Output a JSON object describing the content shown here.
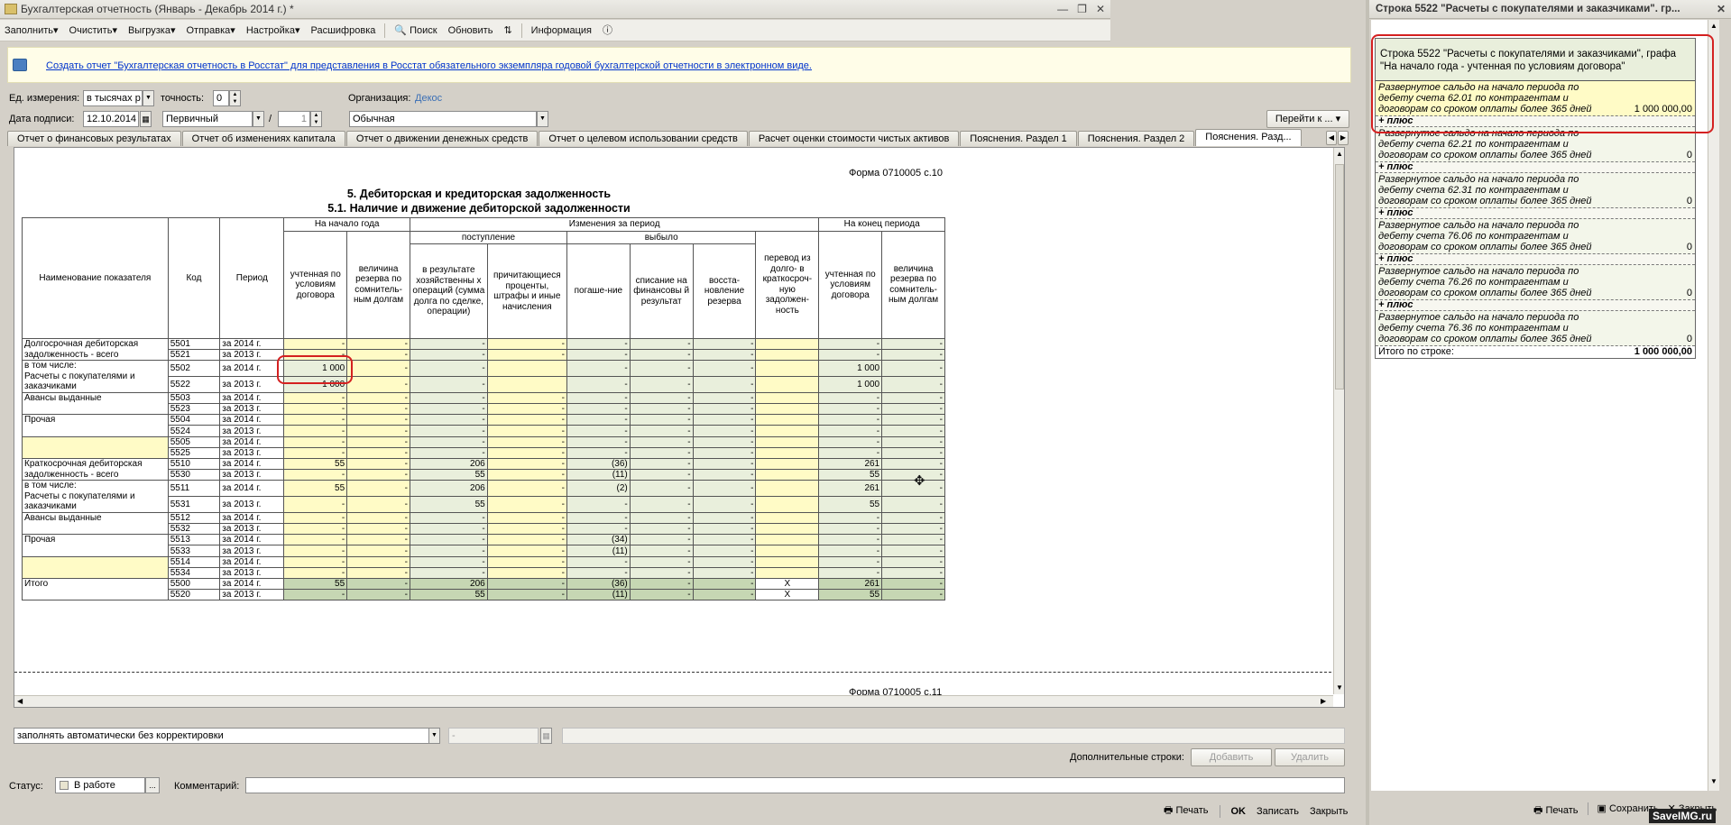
{
  "window": {
    "title": "Бухгалтерская отчетность (Январь - Декабрь 2014 г.) *",
    "right_title": "Строка 5522 \"Расчеты с покупателями и заказчиками\". гр..."
  },
  "toolbar": {
    "items": [
      {
        "label": "Заполнить",
        "arrow": "▾"
      },
      {
        "label": "Очистить",
        "arrow": "▾"
      },
      {
        "label": "Выгрузка",
        "arrow": "▾"
      },
      {
        "label": "Отправка",
        "arrow": "▾"
      },
      {
        "label": "Настройка",
        "arrow": "▾"
      },
      {
        "label": "Расшифровка",
        "arrow": ""
      },
      {
        "label": "Поиск",
        "arrow": ""
      },
      {
        "label": "Обновить",
        "arrow": ""
      },
      {
        "label": "Информация",
        "arrow": ""
      }
    ]
  },
  "info_link": "Создать отчет \"Бухгалтерская отчетность в Росстат\" для представления в Росстат обязательного экземпляра годовой бухгалтерской отчетности в электронном виде.",
  "form": {
    "units_label": "Ед. измерения:",
    "units_value": "в тысячах р",
    "precision_label": "точность:",
    "precision_value": "0",
    "org_label": "Организация:",
    "org_value": "Декос",
    "sign_date_label": "Дата подписи:",
    "sign_date_value": "12.10.2014",
    "kind_value": "Первичный",
    "slash": "/",
    "corr_value": "1",
    "type_value": "Обычная",
    "goto_label": "Перейти к ..."
  },
  "tabs": [
    {
      "label": "Отчет о финансовых результатах",
      "active": false
    },
    {
      "label": "Отчет об изменениях капитала",
      "active": false
    },
    {
      "label": "Отчет о движении денежных средств",
      "active": false
    },
    {
      "label": "Отчет о целевом использовании средств",
      "active": false
    },
    {
      "label": "Расчет оценки стоимости чистых активов",
      "active": false
    },
    {
      "label": "Пояснения. Раздел 1",
      "active": false
    },
    {
      "label": "Пояснения. Раздел 2",
      "active": false
    },
    {
      "label": "Пояснения. Разд...",
      "active": true
    }
  ],
  "report": {
    "form_code_top": "Форма 0710005 с.10",
    "form_code_bottom": "Форма 0710005 с.11",
    "title": "5. Дебиторская и кредиторская задолженность",
    "subtitle": "5.1. Наличие и движение дебиторской задолженности",
    "headers": {
      "name": "Наименование показателя",
      "code": "Код",
      "period": "Период",
      "start": "На начало года",
      "changes": "Изменения за период",
      "end": "На конец периода",
      "income": "поступление",
      "outflow": "выбыло",
      "c1": "учтенная по условиям договора",
      "c2": "величина резерва по сомнитель-ным долгам",
      "c3": "в результате хозяйственны х операций (сумма долга по сделке, операции)",
      "c4": "причитающиеся проценты, штрафы и иные начисления",
      "c5": "погаше-ние",
      "c6": "списание на финансовы й результат",
      "c7": "восста-новление резерва",
      "c8": "перевод из долго- в краткосроч-ную задолжен-ность",
      "c9": "учтенная по условиям договора",
      "c10": "величина резерва по сомнитель-ным долгам"
    },
    "groups": [
      {
        "name": "Долгосрочная дебиторская задолженность - всего",
        "rows": [
          {
            "code": "5501",
            "period": "за 2014 г.",
            "v": [
              "-",
              "-",
              "-",
              "-",
              "-",
              "-",
              "-",
              "",
              "-",
              "-"
            ]
          },
          {
            "code": "5521",
            "period": "за 2013 г.",
            "v": [
              "-",
              "-",
              "-",
              "-",
              "-",
              "-",
              "-",
              "",
              "-",
              "-"
            ]
          }
        ]
      },
      {
        "name": "в том числе:\nРасчеты с покупателями и заказчиками",
        "rows": [
          {
            "code": "5502",
            "period": "за 2014 г.",
            "v": [
              "1 000",
              "-",
              "-",
              "",
              "-",
              "-",
              "-",
              "",
              "1 000",
              "-"
            ]
          },
          {
            "code": "5522",
            "period": "за 2013 г.",
            "v": [
              "1 000",
              "-",
              "-",
              "",
              "-",
              "-",
              "-",
              "",
              "1 000",
              "-"
            ]
          }
        ]
      },
      {
        "name": "Авансы выданные",
        "rows": [
          {
            "code": "5503",
            "period": "за 2014 г.",
            "v": [
              "-",
              "-",
              "-",
              "-",
              "-",
              "-",
              "-",
              "",
              "-",
              "-"
            ]
          },
          {
            "code": "5523",
            "period": "за 2013 г.",
            "v": [
              "-",
              "-",
              "-",
              "-",
              "-",
              "-",
              "-",
              "",
              "-",
              "-"
            ]
          }
        ]
      },
      {
        "name": "Прочая",
        "rows": [
          {
            "code": "5504",
            "period": "за 2014 г.",
            "v": [
              "-",
              "-",
              "-",
              "-",
              "-",
              "-",
              "-",
              "",
              "-",
              "-"
            ]
          },
          {
            "code": "5524",
            "period": "за 2013 г.",
            "v": [
              "-",
              "-",
              "-",
              "-",
              "-",
              "-",
              "-",
              "",
              "-",
              "-"
            ]
          }
        ]
      },
      {
        "name": "",
        "rows": [
          {
            "code": "5505",
            "period": "за 2014 г.",
            "v": [
              "-",
              "-",
              "-",
              "-",
              "-",
              "-",
              "-",
              "",
              "-",
              "-"
            ]
          },
          {
            "code": "5525",
            "period": "за 2013 г.",
            "v": [
              "-",
              "-",
              "-",
              "-",
              "-",
              "-",
              "-",
              "",
              "-",
              "-"
            ]
          }
        ]
      },
      {
        "name": "Краткосрочная дебиторская задолженность - всего",
        "rows": [
          {
            "code": "5510",
            "period": "за 2014 г.",
            "v": [
              "55",
              "-",
              "206",
              "-",
              "(36)",
              "-",
              "-",
              "",
              "261",
              "-"
            ]
          },
          {
            "code": "5530",
            "period": "за 2013 г.",
            "v": [
              "-",
              "-",
              "55",
              "-",
              "(11)",
              "-",
              "-",
              "",
              "55",
              "-"
            ]
          }
        ]
      },
      {
        "name": "в том числе:\nРасчеты с покупателями и заказчиками",
        "rows": [
          {
            "code": "5511",
            "period": "за 2014 г.",
            "v": [
              "55",
              "-",
              "206",
              "-",
              "(2)",
              "-",
              "-",
              "",
              "261",
              "-"
            ]
          },
          {
            "code": "5531",
            "period": "за 2013 г.",
            "v": [
              "-",
              "-",
              "55",
              "-",
              "-",
              "-",
              "-",
              "",
              "55",
              "-"
            ]
          }
        ]
      },
      {
        "name": "Авансы выданные",
        "rows": [
          {
            "code": "5512",
            "period": "за 2014 г.",
            "v": [
              "-",
              "-",
              "-",
              "-",
              "-",
              "-",
              "-",
              "",
              "-",
              "-"
            ]
          },
          {
            "code": "5532",
            "period": "за 2013 г.",
            "v": [
              "-",
              "-",
              "-",
              "-",
              "-",
              "-",
              "-",
              "",
              "-",
              "-"
            ]
          }
        ]
      },
      {
        "name": "Прочая",
        "rows": [
          {
            "code": "5513",
            "period": "за 2014 г.",
            "v": [
              "-",
              "-",
              "-",
              "-",
              "(34)",
              "-",
              "-",
              "",
              "-",
              "-"
            ]
          },
          {
            "code": "5533",
            "period": "за 2013 г.",
            "v": [
              "-",
              "-",
              "-",
              "-",
              "(11)",
              "-",
              "-",
              "",
              "-",
              "-"
            ]
          }
        ]
      },
      {
        "name": "",
        "rows": [
          {
            "code": "5514",
            "period": "за 2014 г.",
            "v": [
              "-",
              "-",
              "-",
              "-",
              "-",
              "-",
              "-",
              "",
              "-",
              "-"
            ]
          },
          {
            "code": "5534",
            "period": "за 2013 г.",
            "v": [
              "-",
              "-",
              "-",
              "-",
              "-",
              "-",
              "-",
              "",
              "-",
              "-"
            ]
          }
        ]
      },
      {
        "name": "Итого",
        "rows": [
          {
            "code": "5500",
            "period": "за 2014 г.",
            "v": [
              "55",
              "-",
              "206",
              "-",
              "(36)",
              "-",
              "-",
              "X",
              "261",
              "-"
            ]
          },
          {
            "code": "5520",
            "period": "за 2013 г.",
            "v": [
              "-",
              "-",
              "55",
              "-",
              "(11)",
              "-",
              "-",
              "X",
              "55",
              "-"
            ]
          }
        ]
      }
    ]
  },
  "bottom": {
    "fill_mode": "заполнять автоматически без корректировки",
    "extra_rows_label": "Дополнительные строки:",
    "add_label": "Добавить",
    "delete_label": "Удалить",
    "status_label": "Статус:",
    "status_value": "В работе",
    "comment_label": "Комментарий:",
    "print_label": "Печать",
    "ok_label": "OK",
    "save_label": "Записать",
    "close_label": "Закрыть"
  },
  "right_panel": {
    "header": "Строка 5522 \"Расчеты с покупателями и заказчиками\", графа \"На начало года - учтенная по условиям договора\"",
    "blocks": [
      {
        "line1": "Развернутое сальдо на начало периода по",
        "line2": "дебету счета 62.01 по контрагентам и",
        "line3": "договорам со сроком оплаты более 365 дней",
        "value": "1 000 000,00"
      },
      {
        "line1": "Развернутое сальдо на начало периода по",
        "line2": "дебету счета 62.21 по контрагентам и",
        "line3": "договорам со сроком оплаты более 365 дней",
        "value": "0"
      },
      {
        "line1": "Развернутое сальдо на начало периода по",
        "line2": "дебету счета 62.31 по контрагентам и",
        "line3": "договорам со сроком оплаты более 365 дней",
        "value": "0"
      },
      {
        "line1": "Развернутое сальдо на начало периода по",
        "line2": "дебету счета 76.06 по контрагентам и",
        "line3": "договорам со сроком оплаты более 365 дней",
        "value": "0"
      },
      {
        "line1": "Развернутое сальдо на начало периода по",
        "line2": "дебету счета 76.26 по контрагентам и",
        "line3": "договорам со сроком оплаты более 365 дней",
        "value": "0"
      },
      {
        "line1": "Развернутое сальдо на начало периода по",
        "line2": "дебету счета 76.36 по контрагентам и",
        "line3": "договорам со сроком оплаты более 365 дней",
        "value": "0"
      }
    ],
    "plus_label": "+ плюс",
    "total_label": "Итого по строке:",
    "total_value": "1 000 000,00",
    "print_label": "Печать",
    "save_label": "Сохранить",
    "close_label": "Закрыть"
  },
  "watermark": "SaveIMG.ru"
}
